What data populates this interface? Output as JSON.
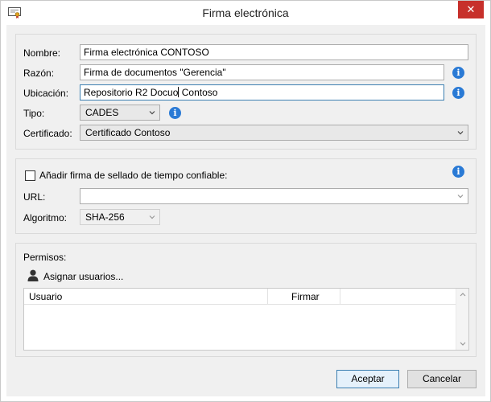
{
  "window": {
    "title": "Firma electrónica",
    "close_glyph": "✕"
  },
  "signature": {
    "name_label": "Nombre:",
    "name_value": "Firma electrónica CONTOSO",
    "reason_label": "Razón:",
    "reason_value": "Firma de documentos \"Gerencia\"",
    "location_label": "Ubicación:",
    "location_value_before_caret": "Repositorio R2 Docuo",
    "location_value_after_caret": " Contoso",
    "type_label": "Tipo:",
    "type_value": "CADES",
    "certificate_label": "Certificado:",
    "certificate_value": "Certificado Contoso"
  },
  "timestamp": {
    "checkbox_label": "Añadir firma de sellado de tiempo confiable:",
    "checked": false,
    "url_label": "URL:",
    "url_value": "",
    "algorithm_label": "Algoritmo:",
    "algorithm_value": "SHA-256"
  },
  "permissions": {
    "title": "Permisos:",
    "assign_users": "Asignar usuarios...",
    "columns": [
      "Usuario",
      "Firmar"
    ],
    "rows": []
  },
  "footer": {
    "accept": "Aceptar",
    "cancel": "Cancelar"
  },
  "icons": {
    "info": "info-icon",
    "app": "certificate-icon",
    "person": "person-icon"
  },
  "colors": {
    "info_blue": "#2a7ad5",
    "close_red": "#c7302b",
    "focus_border": "#3c7fb1"
  }
}
